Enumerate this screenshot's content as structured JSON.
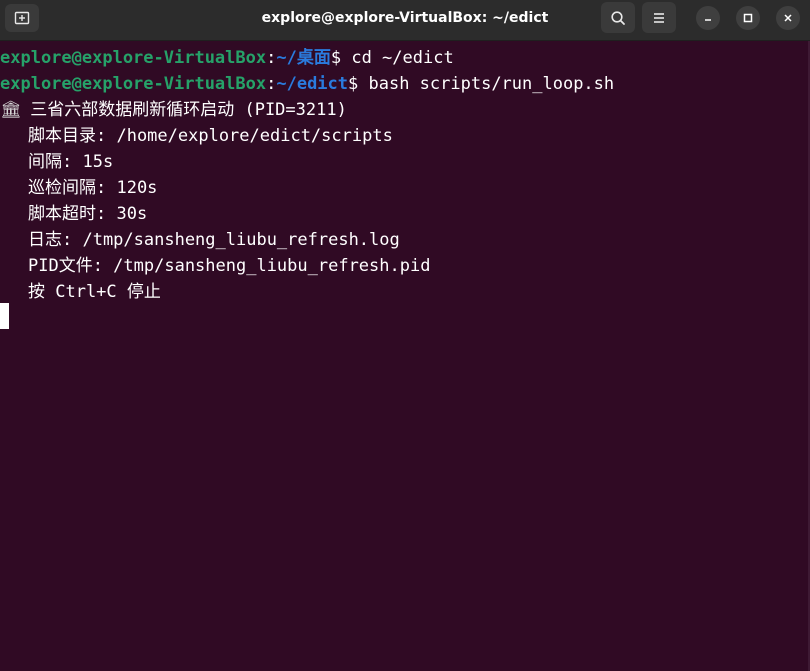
{
  "window": {
    "title": "explore@explore-VirtualBox: ~/edict"
  },
  "prompt1": {
    "user_host": "explore@explore-VirtualBox",
    "sep": ":",
    "path": "~/桌面",
    "dollar": "$ ",
    "command": "cd ~/edict"
  },
  "prompt2": {
    "user_host": "explore@explore-VirtualBox",
    "sep": ":",
    "path": "~/edict",
    "dollar": "$ ",
    "command": "bash scripts/run_loop.sh"
  },
  "output": {
    "start_icon": "🏛",
    "start_line": " 三省六部数据刷新循环启动 (PID=3211)",
    "script_dir": "脚本目录: /home/explore/edict/scripts",
    "interval": "间隔: 15s",
    "patrol_interval": "巡检间隔: 120s",
    "script_timeout": "脚本超时: 30s",
    "log": "日志: /tmp/sansheng_liubu_refresh.log",
    "pid_file": "PID文件: /tmp/sansheng_liubu_refresh.pid",
    "stop_hint": "按 Ctrl+C 停止"
  },
  "colors": {
    "background": "#300a24",
    "prompt_user": "#26a269",
    "prompt_path": "#2a7bde",
    "titlebar": "#2c2c2c"
  },
  "icons": {
    "new_tab": "new-tab-icon",
    "search": "search-icon",
    "menu": "hamburger-menu-icon",
    "minimize": "minimize-icon",
    "maximize": "maximize-icon",
    "close": "close-icon"
  }
}
